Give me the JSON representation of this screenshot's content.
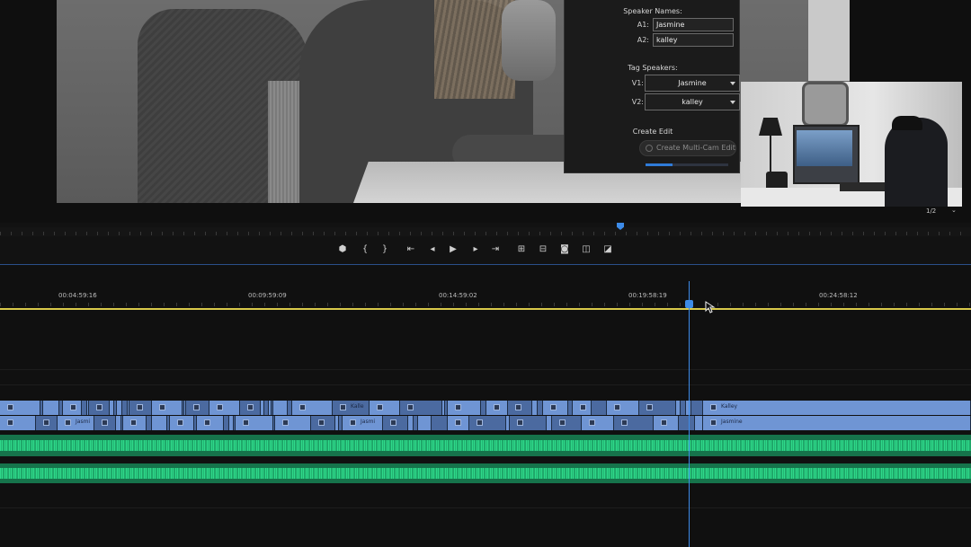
{
  "dialog": {
    "speaker_names_title": "Speaker Names:",
    "a1_label": "A1:",
    "a1_value": "Jasmine",
    "a2_label": "A2:",
    "a2_value": "kalley",
    "tag_speakers_title": "Tag Speakers:",
    "v1_label": "V1:",
    "v1_selected": "Jasmine",
    "v2_label": "V2:",
    "v2_selected": "kalley",
    "create_edit_title": "Create Edit",
    "create_button": "Create Multi-Cam Edit",
    "progress": 0.33
  },
  "monitor": {
    "resolution": "1/2"
  },
  "transport": {
    "icons": [
      "marker-icon",
      "mark-in-icon",
      "mark-out-icon",
      "go-to-in-icon",
      "step-back-icon",
      "play-icon",
      "step-forward-icon",
      "go-to-out-icon",
      "insert-icon",
      "overwrite-icon",
      "camera-icon",
      "compare-icon",
      "export-frame-icon"
    ],
    "glyphs": [
      "⬢",
      "{",
      "}",
      "⇤",
      "◂",
      "▶",
      "▸",
      "⇥",
      "⊞",
      "⊟",
      "◙",
      "◫",
      "◪"
    ]
  },
  "timeline": {
    "timecodes": [
      "00:04:59:16",
      "00:09:59:09",
      "00:14:59:02",
      "00:19:58:19",
      "00:24:58:12"
    ],
    "clip_labels": {
      "v2_short": "Kalle",
      "v1_short": "Jasmi",
      "v2_end": "Kalley",
      "v1_end": "Jasmine"
    }
  },
  "colors": {
    "accent": "#3d8be8",
    "video_clip": "#6f95d4",
    "audio_clip": "#16734b",
    "work_area": "#d9c94a"
  }
}
